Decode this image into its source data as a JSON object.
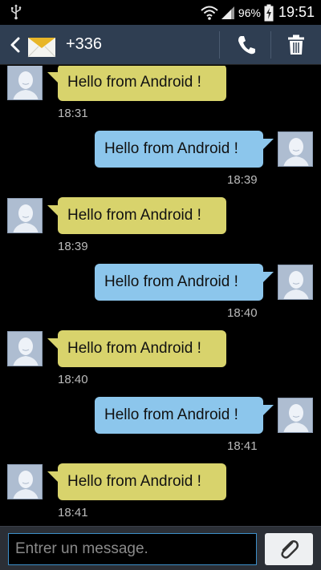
{
  "status_bar": {
    "battery": "96%",
    "time": "19:51",
    "icons": [
      "usb-icon",
      "wifi-icon",
      "signal-icon",
      "battery-charging-icon"
    ]
  },
  "header": {
    "contact": "+336",
    "icons": [
      "back-icon",
      "envelope-icon",
      "phone-icon",
      "trash-icon"
    ]
  },
  "colors": {
    "action_bar": "#2f3e52",
    "incoming_bubble": "#d8d36c",
    "outgoing_bubble": "#8cc6ec",
    "input_border": "#3d8fc9"
  },
  "messages": [
    {
      "direction": "incoming",
      "text": "Hello from Android !",
      "time": "18:31"
    },
    {
      "direction": "outgoing",
      "text": "Hello from Android !",
      "time": "18:39"
    },
    {
      "direction": "incoming",
      "text": "Hello from Android !",
      "time": "18:39"
    },
    {
      "direction": "outgoing",
      "text": "Hello from Android !",
      "time": "18:40"
    },
    {
      "direction": "incoming",
      "text": "Hello from Android !",
      "time": "18:40"
    },
    {
      "direction": "outgoing",
      "text": "Hello from Android !",
      "time": "18:41"
    },
    {
      "direction": "incoming",
      "text": "Hello from Android !",
      "time": "18:41"
    }
  ],
  "composer": {
    "placeholder": "Entrer un message.",
    "value": "",
    "attach_icon": "paperclip-icon"
  }
}
